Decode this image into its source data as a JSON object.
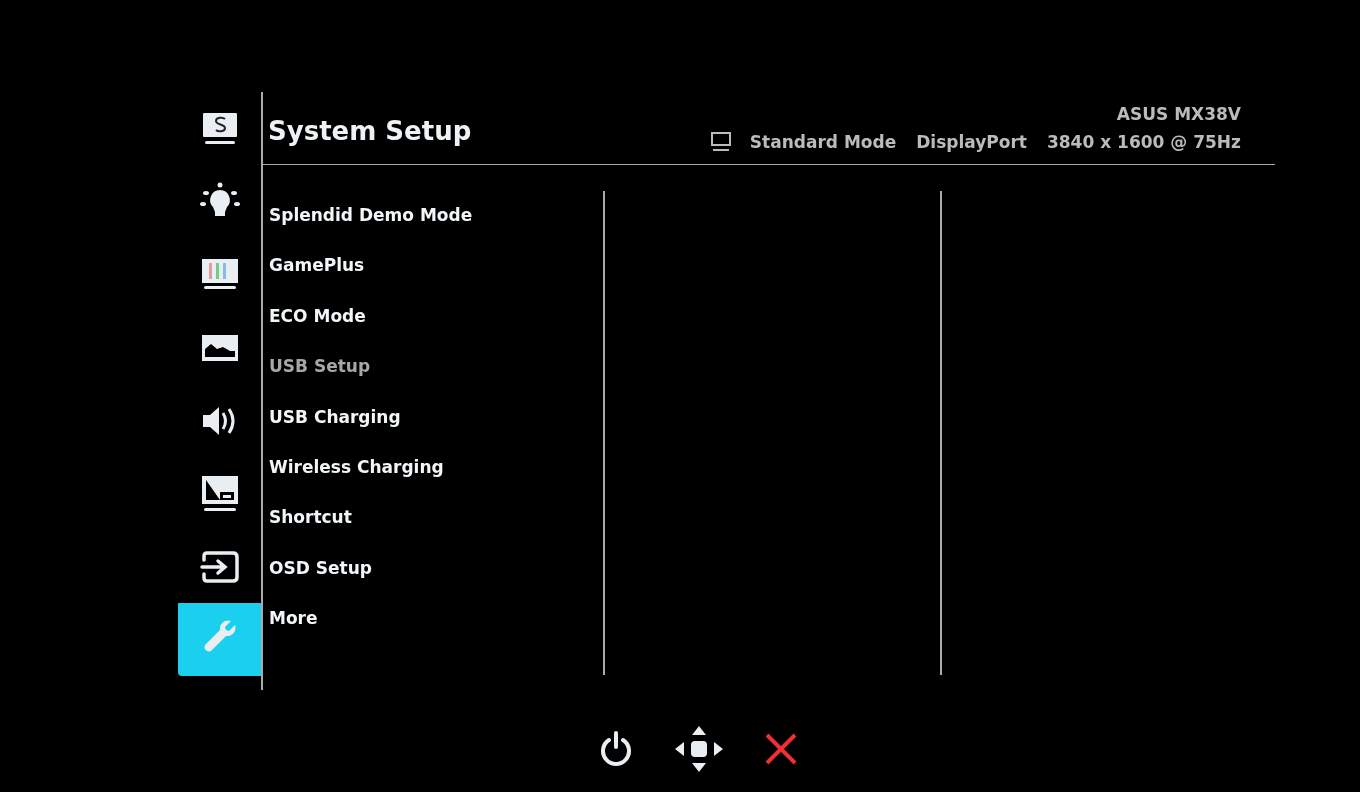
{
  "sidebar": {
    "items": [
      {
        "kind": "splendid",
        "selected": false
      },
      {
        "kind": "bulb",
        "selected": false
      },
      {
        "kind": "color",
        "selected": false
      },
      {
        "kind": "image",
        "selected": false
      },
      {
        "kind": "sound",
        "selected": false
      },
      {
        "kind": "pip",
        "selected": false
      },
      {
        "kind": "input",
        "selected": false
      },
      {
        "kind": "wrench",
        "selected": true
      }
    ]
  },
  "header": {
    "title": "System Setup",
    "model": "ASUS MX38V",
    "mode": "Standard Mode",
    "input": "DisplayPort",
    "resolution": "3840 x 1600 @ 75Hz"
  },
  "menu": {
    "items": [
      {
        "label": "Splendid Demo Mode",
        "disabled": false
      },
      {
        "label": "GamePlus",
        "disabled": false
      },
      {
        "label": "ECO Mode",
        "disabled": false
      },
      {
        "label": "USB Setup",
        "disabled": true
      },
      {
        "label": "USB Charging",
        "disabled": false
      },
      {
        "label": "Wireless Charging",
        "disabled": false
      },
      {
        "label": "Shortcut",
        "disabled": false
      },
      {
        "label": "OSD Setup",
        "disabled": false
      },
      {
        "label": "More",
        "disabled": false
      }
    ]
  },
  "footer": {
    "buttons": [
      {
        "kind": "power"
      },
      {
        "kind": "joystick"
      },
      {
        "kind": "close"
      }
    ]
  }
}
